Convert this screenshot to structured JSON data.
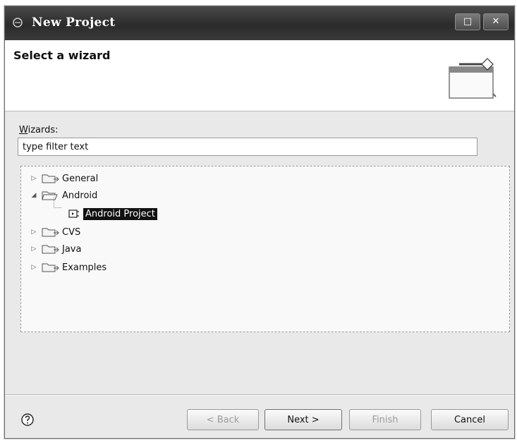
{
  "window": {
    "title": "New Project",
    "controls": {
      "maximize": "□",
      "close": "✕"
    }
  },
  "header": {
    "title": "Select a wizard"
  },
  "wizards": {
    "label": "Wizards:",
    "label_mnemonic": "W",
    "label_rest": "izards:",
    "filter_placeholder": "type filter text",
    "filter_value": "type filter text"
  },
  "tree": {
    "items": [
      {
        "label": "General",
        "expanded": false,
        "level": 0,
        "icon": "folder-icon"
      },
      {
        "label": "Android",
        "expanded": true,
        "level": 0,
        "icon": "folder-icon"
      },
      {
        "label": "Android Project",
        "level": 1,
        "icon": "android-project-icon",
        "selected": true
      },
      {
        "label": "CVS",
        "expanded": false,
        "level": 0,
        "icon": "folder-icon"
      },
      {
        "label": "Java",
        "expanded": false,
        "level": 0,
        "icon": "folder-icon"
      },
      {
        "label": "Examples",
        "expanded": false,
        "level": 0,
        "icon": "folder-icon"
      }
    ]
  },
  "footer": {
    "help_icon": "question-mark-circle-icon",
    "back_label": "< Back",
    "back_mnemonic": "B",
    "next_label": "Next >",
    "next_mnemonic": "N",
    "finish_label": "Finish",
    "finish_mnemonic": "F",
    "cancel_label": "Cancel"
  },
  "colors": {
    "titlebar": "#2f2f2f",
    "selection": "#111111",
    "dialog_background": "#e9e9e9"
  }
}
